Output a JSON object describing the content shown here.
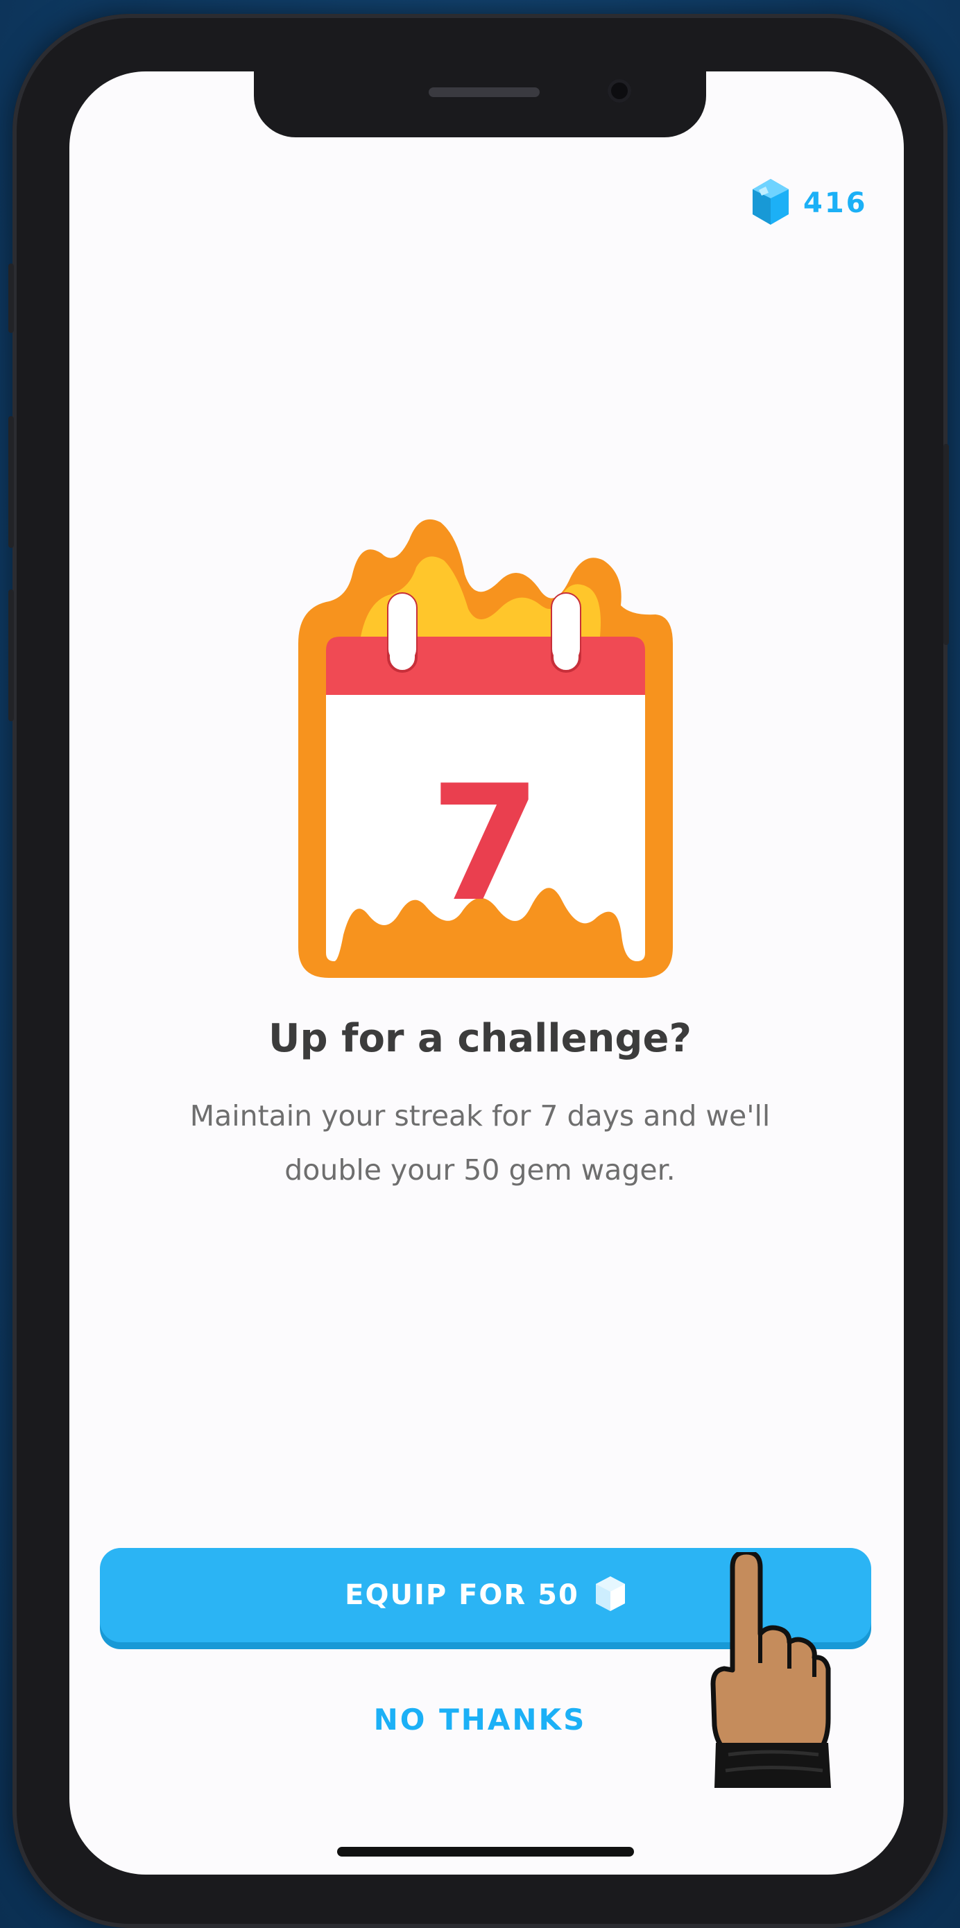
{
  "header": {
    "gem_count": "416",
    "gem_icon": "gem-icon",
    "accent_color": "#1cb0f6"
  },
  "illustration": {
    "icon": "flaming-calendar-icon",
    "day_number": "7"
  },
  "main": {
    "title": "Up for a challenge?",
    "description_line1": "Maintain your streak for 7 days and we'll",
    "description_line2": "double your 50 gem wager."
  },
  "actions": {
    "equip_label": "EQUIP FOR 50",
    "equip_icon": "gem-icon",
    "no_thanks_label": "NO THANKS"
  },
  "overlay": {
    "pointer_icon": "pointing-hand-icon"
  }
}
